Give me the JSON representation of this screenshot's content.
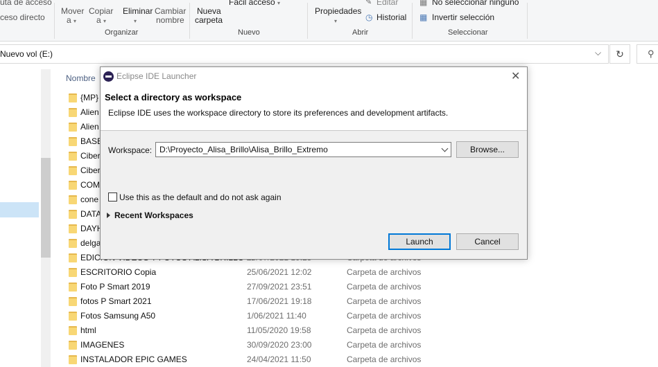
{
  "ribbon": {
    "quick_access_text": "uta de acceso",
    "direct_access_text": "ceso directo",
    "move_label": "Mover",
    "move_sub": "a",
    "copy_label": "Copiar",
    "copy_sub": "a",
    "delete_label": "Eliminar",
    "rename_line1": "Cambiar",
    "rename_line2": "nombre",
    "new_folder_line1": "Nueva",
    "new_folder_line2": "carpeta",
    "easy_access_label": "Fácil acceso",
    "properties_label": "Propiedades",
    "edit_label": "Editar",
    "history_label": "Historial",
    "select_none_label": "No seleccionar ninguno",
    "invert_selection_label": "Invertir selección",
    "groups": {
      "organize": "Organizar",
      "new": "Nuevo",
      "open": "Abrir",
      "select": "Seleccionar"
    }
  },
  "address": {
    "path": "Nuevo vol (E:)"
  },
  "file_list": {
    "name_header": "Nombre",
    "rows": [
      {
        "name": "{MP}",
        "date": "",
        "type": ""
      },
      {
        "name": "Alien",
        "date": "",
        "type": ""
      },
      {
        "name": "Alien",
        "date": "",
        "type": ""
      },
      {
        "name": "BASE",
        "date": "",
        "type": ""
      },
      {
        "name": "Ciber",
        "date": "",
        "type": ""
      },
      {
        "name": "Ciber",
        "date": "",
        "type": ""
      },
      {
        "name": "COM",
        "date": "",
        "type": ""
      },
      {
        "name": "cone",
        "date": "",
        "type": ""
      },
      {
        "name": "DATA",
        "date": "",
        "type": ""
      },
      {
        "name": "DAYH",
        "date": "",
        "type": ""
      },
      {
        "name": "delga",
        "date": "",
        "type": ""
      },
      {
        "name": "EDICION VIDEOS Y FOTOS ALISA BRILLO ...",
        "date": "25/07/2021 19:25",
        "type": "Carpeta de archivos"
      },
      {
        "name": "ESCRITORIO Copia",
        "date": "25/06/2021 12:02",
        "type": "Carpeta de archivos"
      },
      {
        "name": "Foto P Smart 2019",
        "date": "27/09/2021 23:51",
        "type": "Carpeta de archivos"
      },
      {
        "name": "fotos P Smart 2021",
        "date": "17/06/2021 19:18",
        "type": "Carpeta de archivos"
      },
      {
        "name": "Fotos Samsung A50",
        "date": "1/06/2021 11:40",
        "type": "Carpeta de archivos"
      },
      {
        "name": "html",
        "date": "11/05/2020 19:58",
        "type": "Carpeta de archivos"
      },
      {
        "name": "IMAGENES",
        "date": "30/09/2020 23:00",
        "type": "Carpeta de archivos"
      },
      {
        "name": "INSTALADOR EPIC GAMES",
        "date": "24/04/2021 11:50",
        "type": "Carpeta de archivos"
      }
    ]
  },
  "dialog": {
    "title": "Eclipse IDE Launcher",
    "close_glyph": "✕",
    "heading": "Select a directory as workspace",
    "description": "Eclipse IDE uses the workspace directory to store its preferences and development artifacts.",
    "workspace_label": "Workspace:",
    "workspace_value": "D:\\Proyecto_Alisa_Brillo\\Alisa_Brillo_Extremo",
    "browse_label": "Browse...",
    "default_checkbox_label": "Use this as the default and do not ask again",
    "default_checked": false,
    "recent_label": "Recent Workspaces",
    "launch_label": "Launch",
    "cancel_label": "Cancel"
  },
  "colors": {
    "folder": "#f8d775",
    "selection": "#cce4f7",
    "accent": "#0078d7"
  },
  "icons": [
    "folder-icon",
    "refresh-icon",
    "search-icon",
    "eclipse-icon",
    "close-icon",
    "chevron-down-icon",
    "expand-arrow-icon"
  ]
}
